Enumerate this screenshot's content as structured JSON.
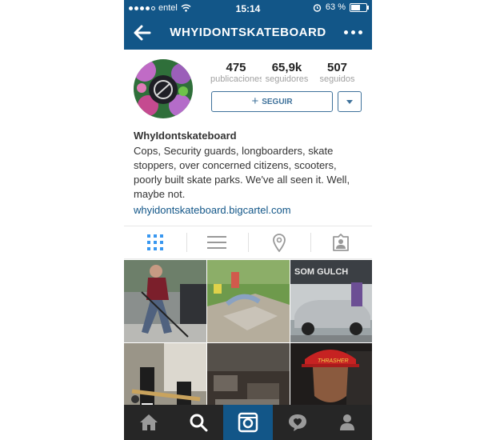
{
  "status_bar": {
    "carrier": "entel",
    "time": "15:14",
    "battery_percent": "63 %",
    "battery_level": 0.63
  },
  "nav": {
    "title": "WHYIDONTSKATEBOARD"
  },
  "profile": {
    "stats": [
      {
        "value": "475",
        "label": "publicaciones"
      },
      {
        "value": "65,9k",
        "label": "seguidores"
      },
      {
        "value": "507",
        "label": "seguidos"
      }
    ],
    "follow_label": "SEGUIR",
    "name": "WhyIdontskateboard",
    "bio": "Cops, Security guards, longboarders, skate stoppers, over concerned citizens, scooters, poorly built skate parks. We've all seen it. Well, maybe not.",
    "website": "whyidontskateboard.bigcartel.com"
  },
  "grid_photos": [
    {
      "label": ""
    },
    {
      "label": ""
    },
    {
      "label": "SOM GULCH"
    },
    {
      "label": ""
    },
    {
      "label": ""
    },
    {
      "label": "THRASHER"
    }
  ],
  "colors": {
    "accent": "#125688",
    "follow": "#3f729b",
    "bottom_bar": "#262626"
  }
}
